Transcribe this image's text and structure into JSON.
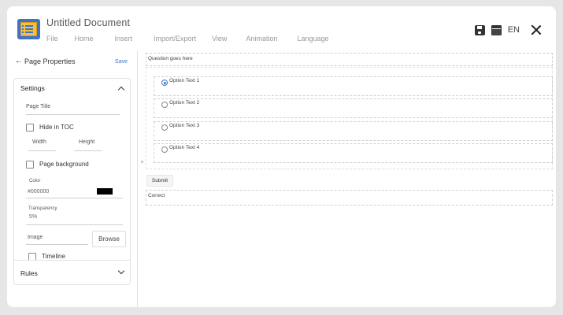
{
  "header": {
    "title": "Untitled Document",
    "menu": [
      "File",
      "Home",
      "Insert",
      "Import/Export",
      "View",
      "Animation",
      "Language"
    ],
    "language": "EN"
  },
  "sidebar": {
    "title": "Page Properties",
    "save_label": "Save",
    "settings": {
      "title": "Settings",
      "page_title_label": "Page Title",
      "hide_in_toc_label": "Hide in TOC",
      "width_label": "Width",
      "height_label": "Height",
      "page_background_label": "Page background",
      "color_label": "Color",
      "color_value": "#000000",
      "transparency_label": "Transparency",
      "transparency_value": "5%",
      "image_label": "Image",
      "browse_label": "Browse",
      "timeline_label": "Timeline"
    },
    "rules_title": "Rules"
  },
  "canvas": {
    "question": "Question goes here",
    "options": [
      "Option Text 1",
      "Option Text 2",
      "Option Text 3",
      "Option Text 4"
    ],
    "selected_option": 1,
    "submit_label": "Submit",
    "feedback": "Correct"
  },
  "colors": {
    "accent": "#3a78c9",
    "logo_blue": "#3e73c9",
    "logo_yellow": "#f6c044",
    "swatch": "#000000"
  },
  "icons": [
    "document-logo-icon",
    "save-icon",
    "window-icon",
    "close-icon",
    "back-arrow-icon",
    "chevron-up-icon",
    "chevron-down-icon"
  ]
}
